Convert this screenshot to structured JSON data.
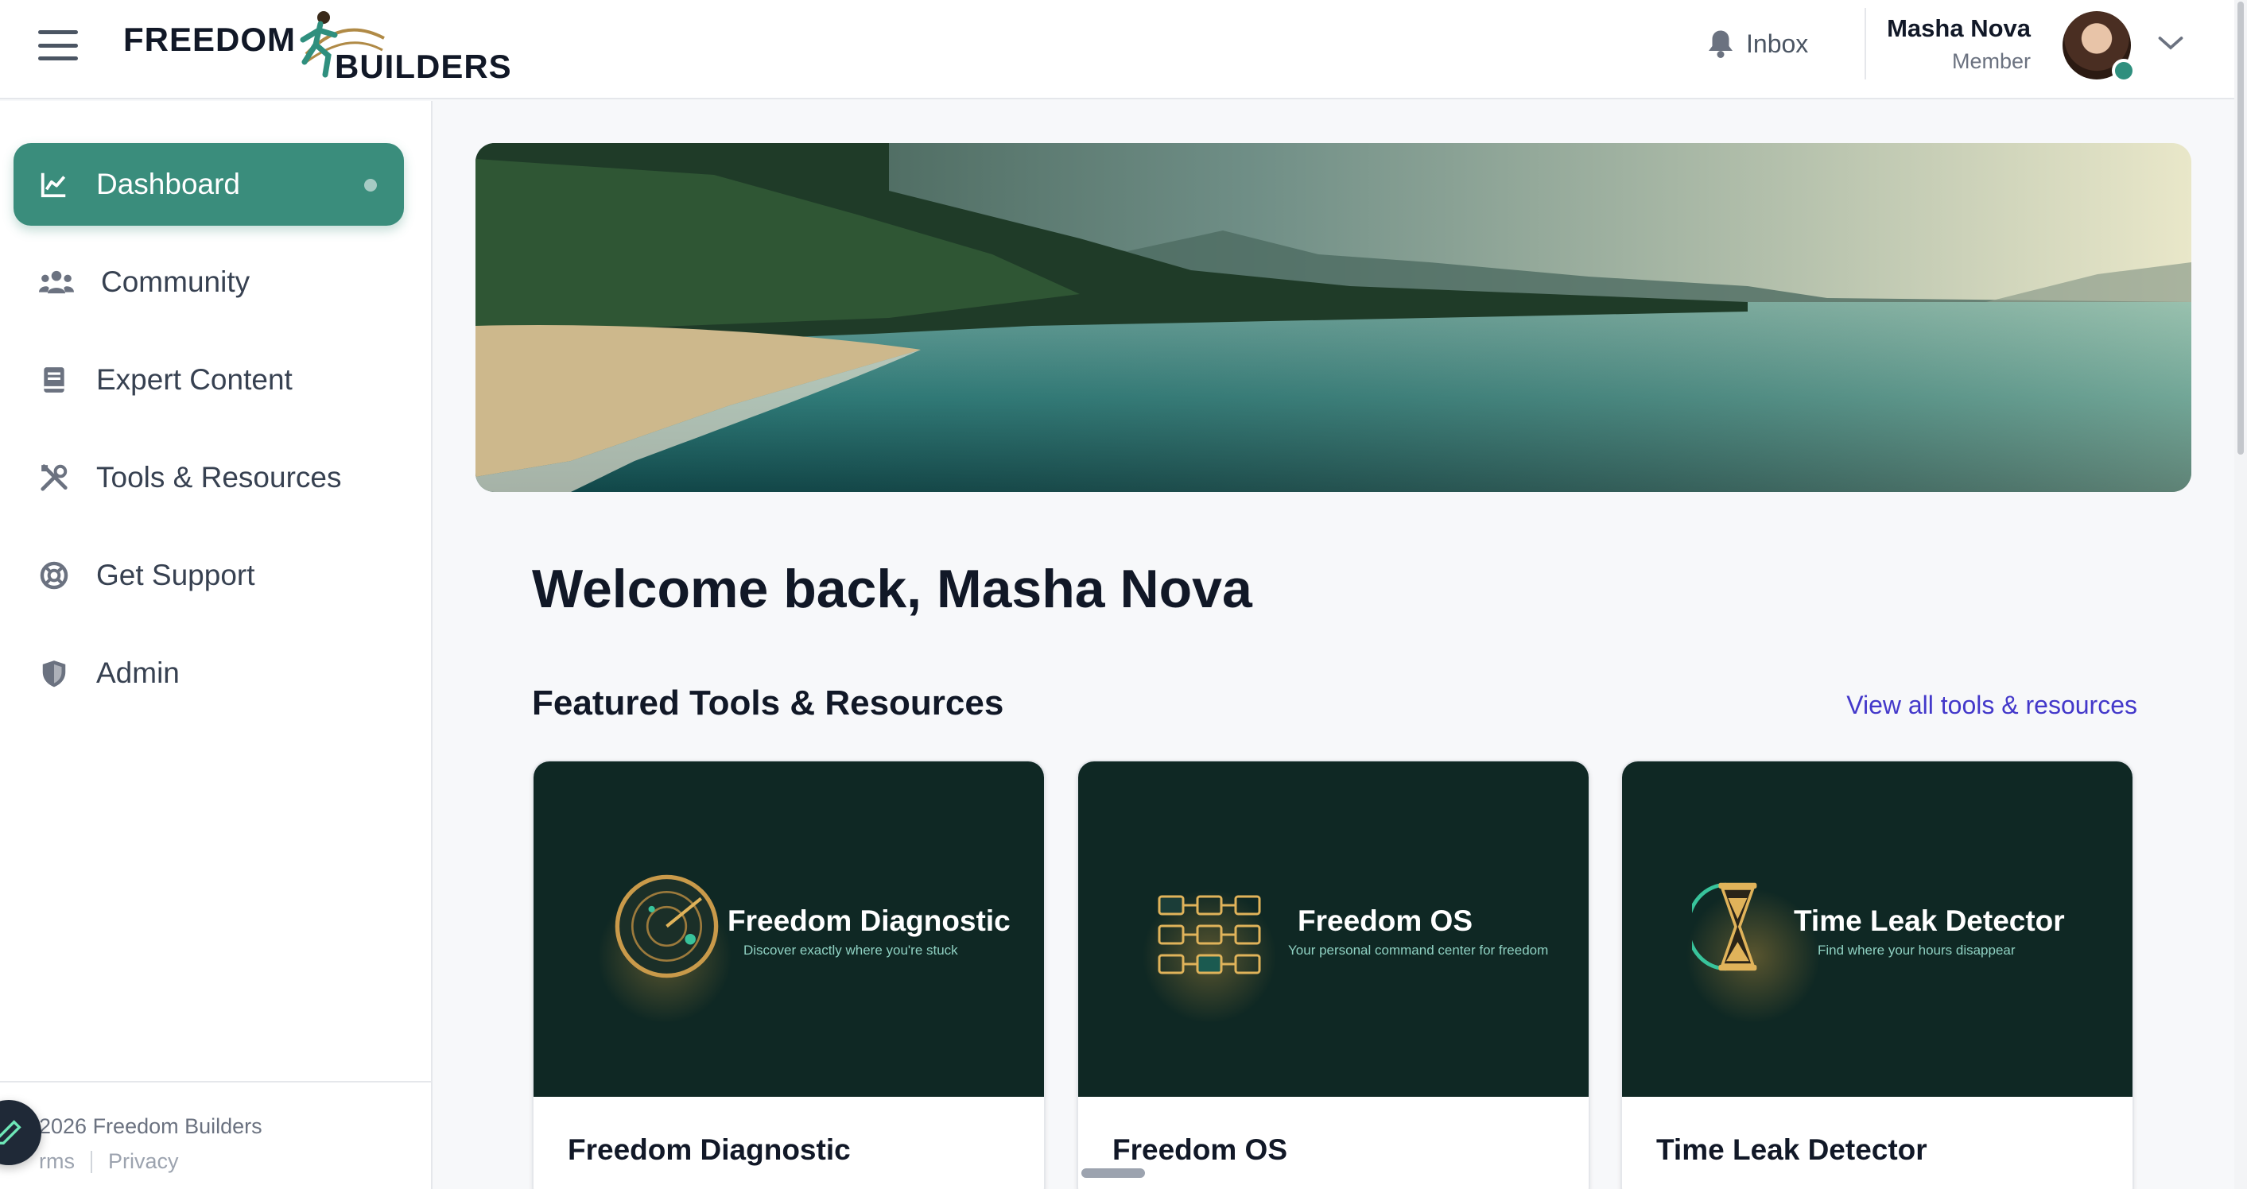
{
  "brand": {
    "line1": "FREEDOM",
    "line2": "BUILDERS"
  },
  "header": {
    "inbox_label": "Inbox",
    "user_name": "Masha Nova",
    "user_role": "Member"
  },
  "sidebar": {
    "items": [
      {
        "label": "Dashboard",
        "icon": "chart-line-icon",
        "active": true
      },
      {
        "label": "Community",
        "icon": "users-icon"
      },
      {
        "label": "Expert Content",
        "icon": "book-icon"
      },
      {
        "label": "Tools & Resources",
        "icon": "tools-icon"
      },
      {
        "label": "Get Support",
        "icon": "lifebuoy-icon"
      },
      {
        "label": "Admin",
        "icon": "shield-icon"
      }
    ],
    "footer": {
      "copyright": "2026 Freedom Builders",
      "terms": "rms",
      "privacy": "Privacy"
    }
  },
  "main": {
    "welcome": "Welcome back, Masha Nova",
    "section_title": "Featured Tools & Resources",
    "view_all": "View all tools & resources",
    "cards": [
      {
        "banner_title": "Freedom Diagnostic",
        "banner_sub": "Discover exactly where you're stuck",
        "title": "Freedom Diagnostic",
        "icon": "radar-icon"
      },
      {
        "banner_title": "Freedom OS",
        "banner_sub": "Your personal command center for freedom",
        "title": "Freedom OS",
        "icon": "grid-icon"
      },
      {
        "banner_title": "Time Leak Detector",
        "banner_sub": "Find where your hours disappear",
        "title": "Time Leak Detector",
        "icon": "hourglass-icon"
      }
    ]
  },
  "colors": {
    "accent": "#3a8d7c",
    "link": "#4338ca",
    "card_banner": "#0f2824"
  }
}
